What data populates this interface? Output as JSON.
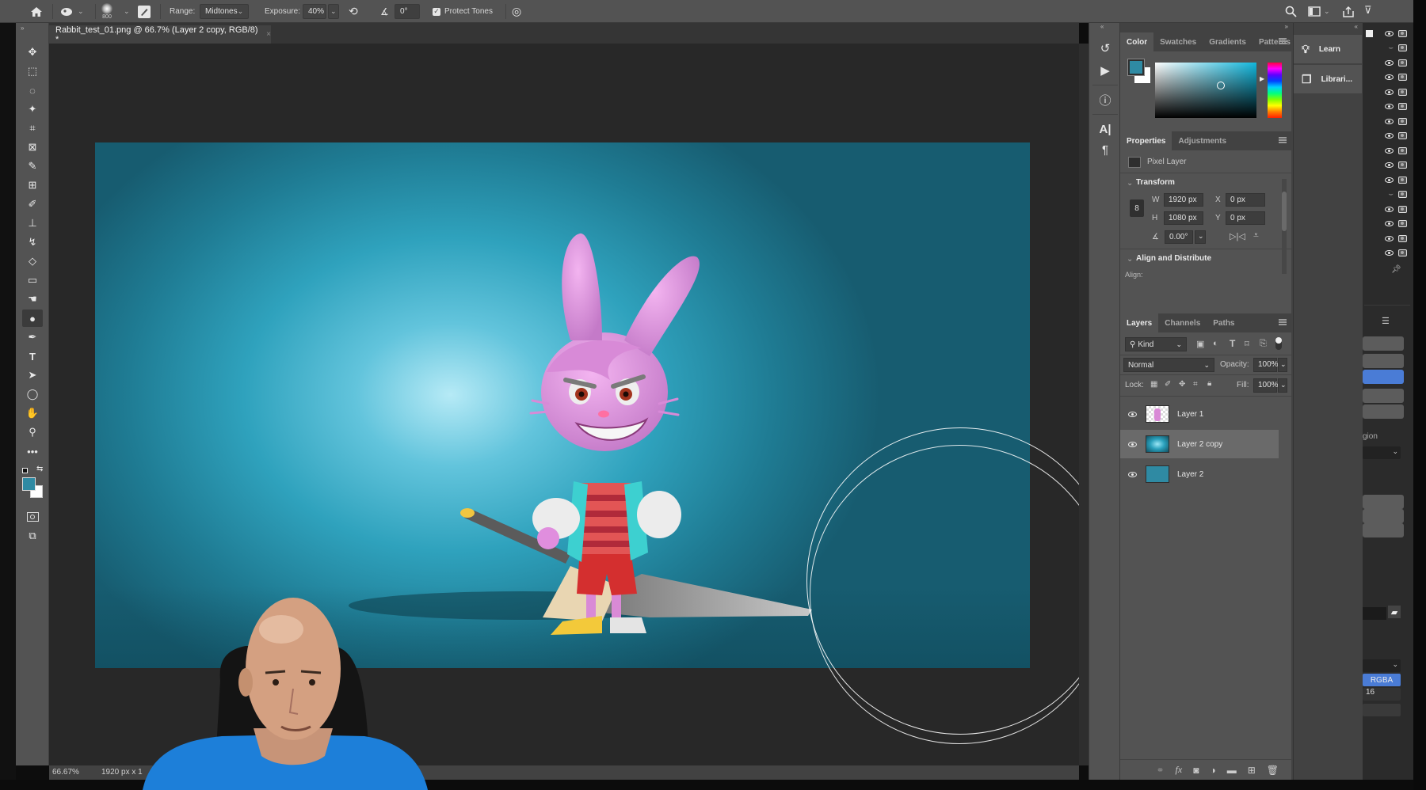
{
  "options_bar": {
    "home_icon": "home-icon",
    "tool_preset_icon": "sponge-tool-icon",
    "brush_size": "800",
    "brush_settings_icon": "brush-settings-icon",
    "range_label": "Range:",
    "range_value": "Midtones",
    "exposure_label": "Exposure:",
    "exposure_value": "40%",
    "airbrush_icon": "airbrush-icon",
    "angle_icon": "angle-icon",
    "angle_value": "0°",
    "protect_tones_checked": true,
    "protect_tones_label": "Protect Tones",
    "pressure_icon": "pressure-icon",
    "right_icons": [
      "search-icon",
      "workspace-icon",
      "share-icon"
    ]
  },
  "document": {
    "tab_title": "Rabbit_test_01.png @ 66.7% (Layer 2 copy, RGB/8) *",
    "close_glyph": "×",
    "zoom": "66.67%",
    "dimensions": "1920 px x 1"
  },
  "tools": [
    {
      "name": "move-tool",
      "glyph": "✥"
    },
    {
      "name": "marquee-tool",
      "glyph": "⬚"
    },
    {
      "name": "lasso-tool",
      "glyph": "◌"
    },
    {
      "name": "magic-wand-tool",
      "glyph": "✦"
    },
    {
      "name": "crop-tool",
      "glyph": "⌗"
    },
    {
      "name": "frame-tool",
      "glyph": "⊠"
    },
    {
      "name": "eyedropper-tool",
      "glyph": "✎"
    },
    {
      "name": "healing-tool",
      "glyph": "⊞"
    },
    {
      "name": "brush-tool",
      "glyph": "✐"
    },
    {
      "name": "clone-stamp-tool",
      "glyph": "⊥"
    },
    {
      "name": "history-brush-tool",
      "glyph": "↯"
    },
    {
      "name": "eraser-tool",
      "glyph": "◇"
    },
    {
      "name": "gradient-tool",
      "glyph": "▭"
    },
    {
      "name": "smudge-tool",
      "glyph": "☚"
    },
    {
      "name": "sponge-tool",
      "glyph": "●",
      "active": true
    },
    {
      "name": "pen-tool",
      "glyph": "✒"
    },
    {
      "name": "type-tool",
      "glyph": "T"
    },
    {
      "name": "path-selection-tool",
      "glyph": "➤"
    },
    {
      "name": "ellipse-tool",
      "glyph": "◯"
    },
    {
      "name": "hand-tool",
      "glyph": "✋"
    },
    {
      "name": "zoom-tool",
      "glyph": "⚲"
    },
    {
      "name": "more-tools",
      "glyph": "•••"
    }
  ],
  "colors": {
    "foreground": "#2f8aa3",
    "background": "#ffffff",
    "accent_blue": "#4a7cd6"
  },
  "color_panel": {
    "tabs": [
      "Color",
      "Swatches",
      "Gradients",
      "Patterns"
    ],
    "active_tab": "Color"
  },
  "properties_panel": {
    "tabs": [
      "Properties",
      "Adjustments"
    ],
    "layer_type": "Pixel Layer",
    "transform_title": "Transform",
    "w_label": "W",
    "w_value": "1920 px",
    "h_label": "H",
    "h_value": "1080 px",
    "x_label": "X",
    "x_value": "0 px",
    "y_label": "Y",
    "y_value": "0 px",
    "angle_value": "0.00°",
    "align_title": "Align and Distribute",
    "align_label": "Align:"
  },
  "layers_panel": {
    "tabs": [
      "Layers",
      "Channels",
      "Paths"
    ],
    "filter_kind": "Kind",
    "blend_mode": "Normal",
    "opacity_label": "Opacity:",
    "opacity_value": "100%",
    "lock_label": "Lock:",
    "fill_label": "Fill:",
    "fill_value": "100%",
    "layers": [
      {
        "name": "Layer 1",
        "visible": true,
        "selected": false
      },
      {
        "name": "Layer 2 copy",
        "visible": true,
        "selected": true
      },
      {
        "name": "Layer 2",
        "visible": true,
        "selected": false
      }
    ],
    "footer_icons": [
      "link-icon",
      "fx-icon",
      "mask-icon",
      "adjustment-icon",
      "folder-icon",
      "new-layer-icon",
      "trash-icon"
    ]
  },
  "side_buttons": {
    "learn": "Learn",
    "libraries": "Librari..."
  },
  "far_right": {
    "region_label": "gion",
    "format_value": "RGBA",
    "depth_value": "16"
  }
}
